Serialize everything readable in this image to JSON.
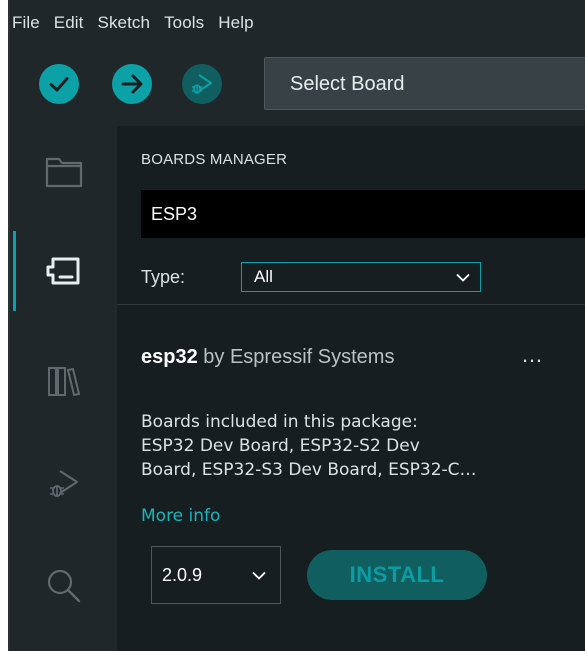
{
  "menubar": {
    "items": [
      "File",
      "Edit",
      "Sketch",
      "Tools",
      "Help"
    ]
  },
  "toolbar": {
    "verify_icon": "check-icon",
    "upload_icon": "arrow-right-icon",
    "debug_icon": "debug-icon",
    "board_select_label": "Select Board"
  },
  "activitybar": {
    "items": [
      {
        "icon": "folder-icon",
        "active": false
      },
      {
        "icon": "boards-manager-icon",
        "active": true
      },
      {
        "icon": "library-icon",
        "active": false
      },
      {
        "icon": "debug-icon",
        "active": false
      },
      {
        "icon": "search-icon",
        "active": false
      }
    ]
  },
  "panel": {
    "title": "BOARDS MANAGER",
    "search_value": "ESP3",
    "type_label": "Type:",
    "type_value": "All"
  },
  "card": {
    "name": "esp32",
    "by_label": "by Espressif Systems",
    "menu_label": "…",
    "desc_label": "Boards included in this package:",
    "desc_text": "ESP32 Dev Board, ESP32-S2 Dev\nBoard, ESP32-S3 Dev Board, ESP32-C…",
    "more_info": "More info",
    "version": "2.0.9",
    "install_label": "INSTALL"
  },
  "colors": {
    "accent": "#0ca1a6",
    "accent_dark": "#115e61",
    "background": "#171e21",
    "chrome": "#20272b"
  }
}
